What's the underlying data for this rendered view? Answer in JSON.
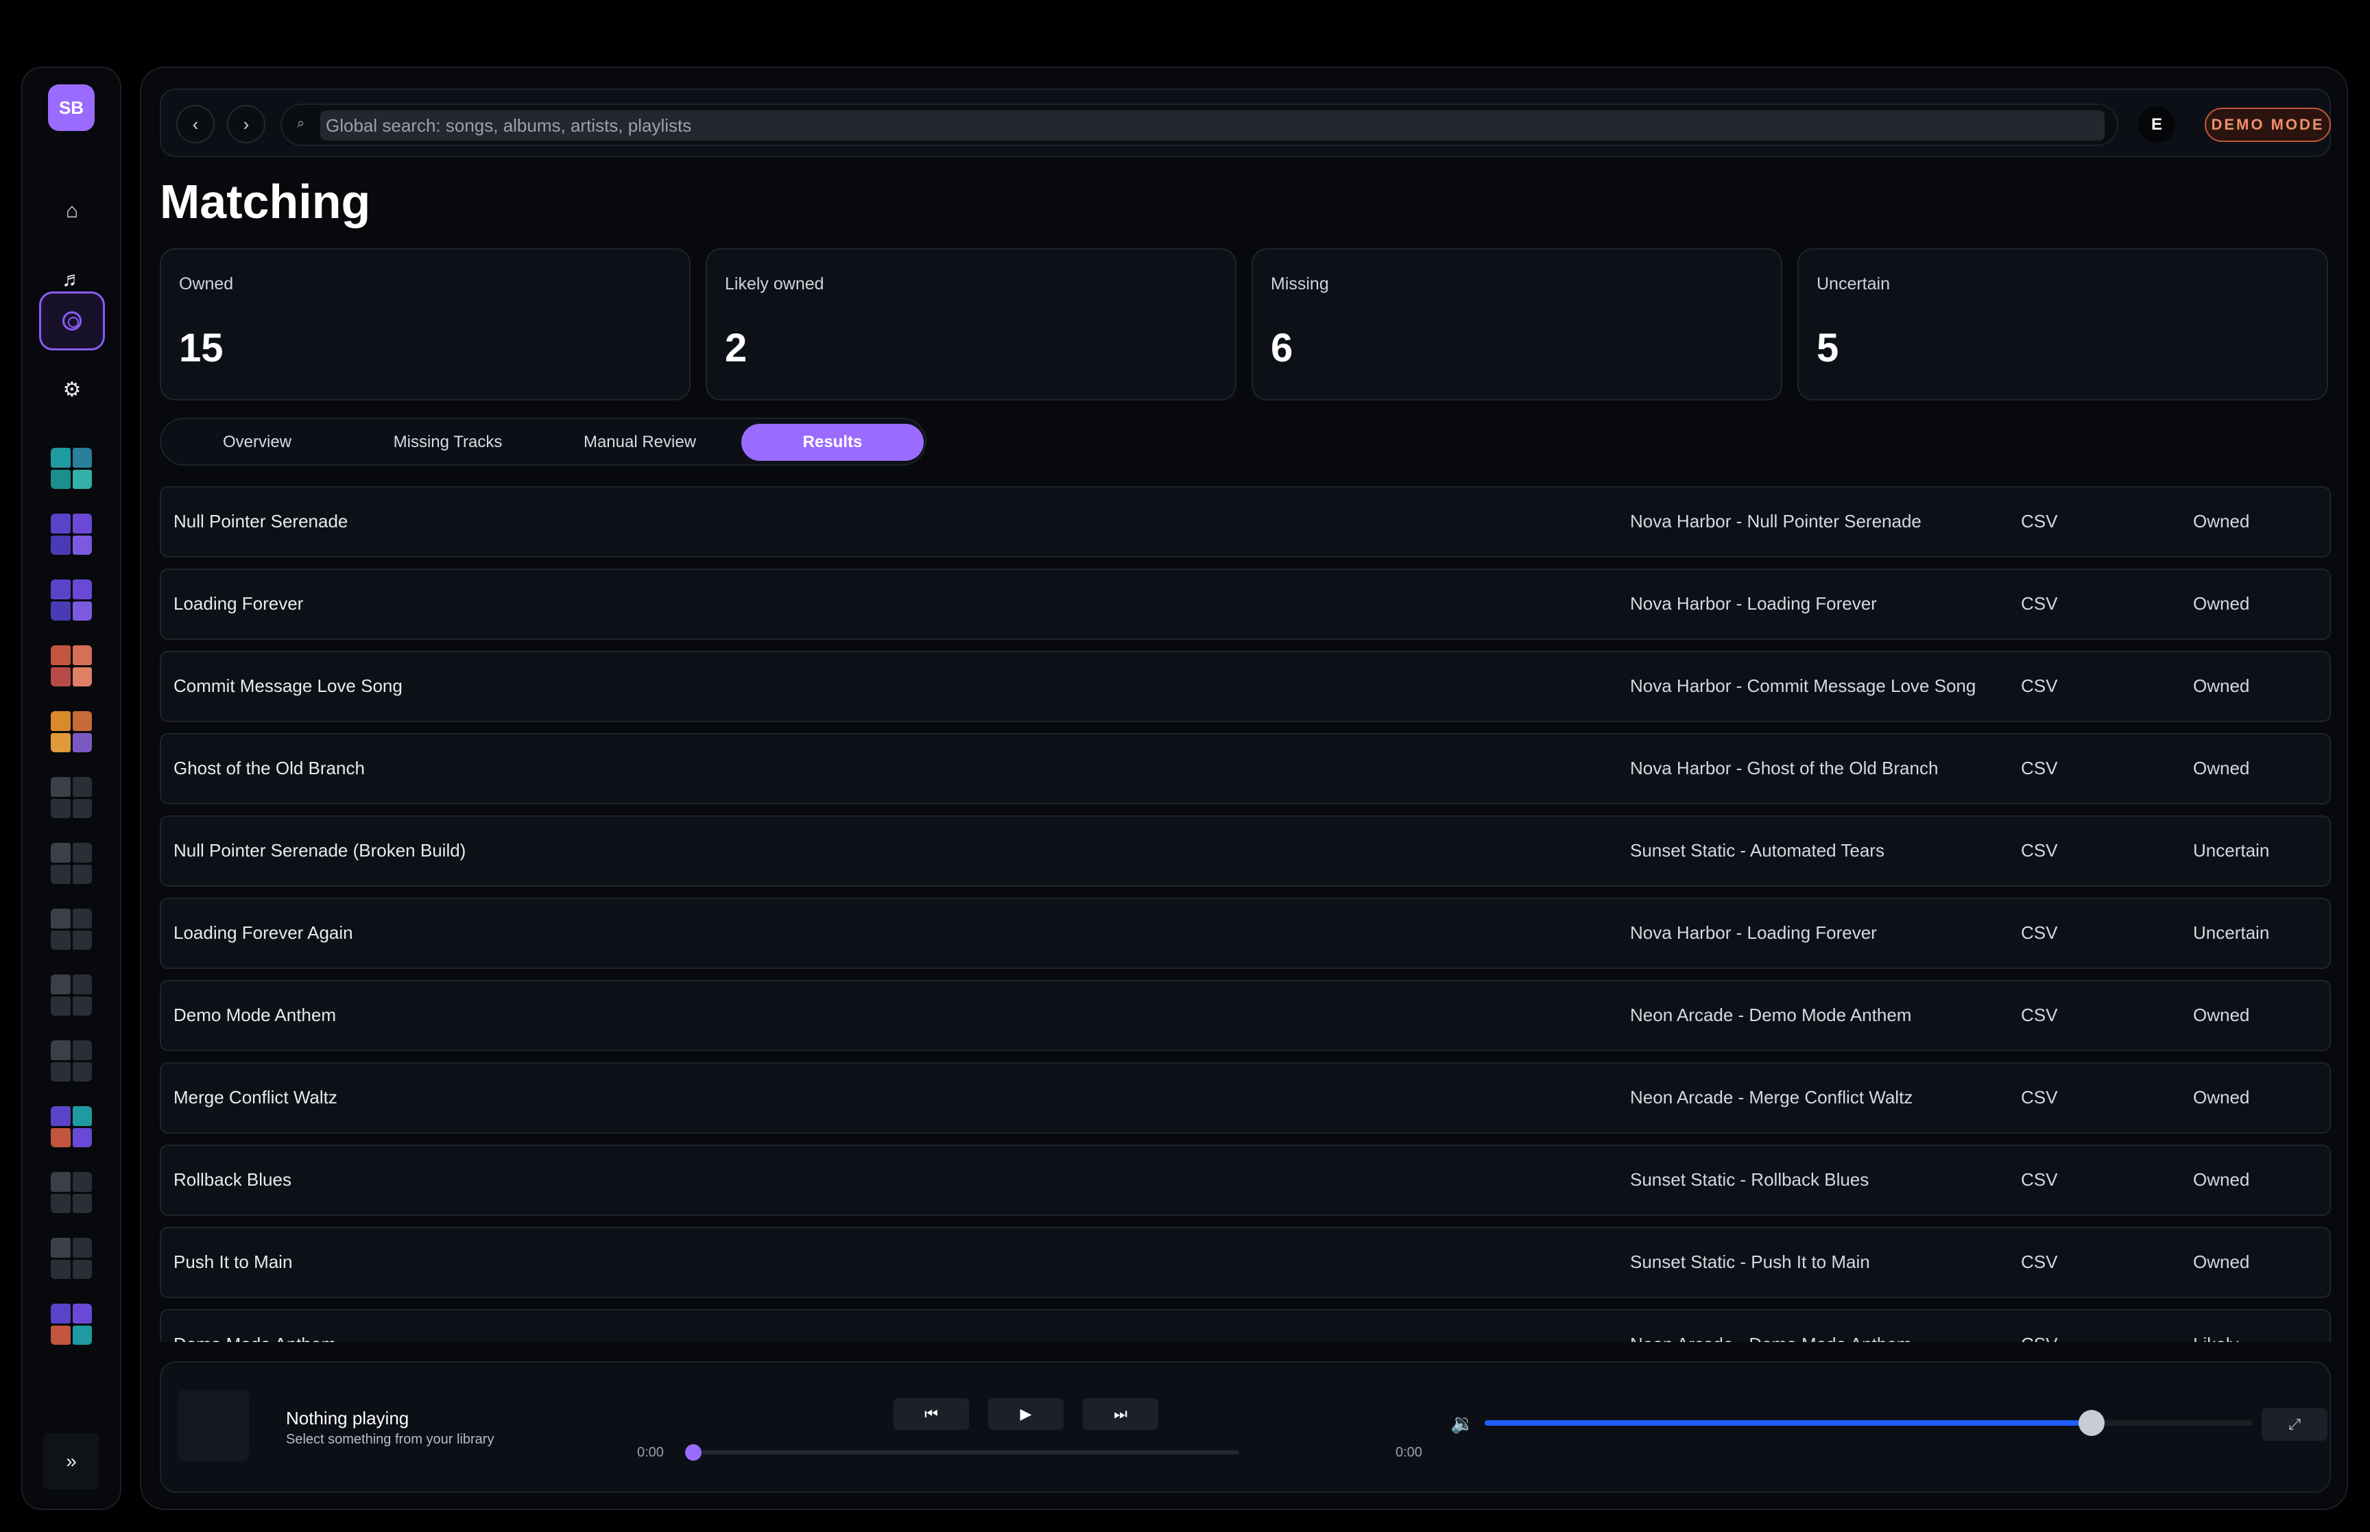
{
  "sidebar": {
    "avatar": "SB",
    "nav": [
      {
        "name": "home-icon",
        "glyph": "⌂"
      },
      {
        "name": "music-note-icon",
        "glyph": "♬"
      },
      {
        "name": "matching-icon",
        "glyph": ""
      },
      {
        "name": "gear-icon",
        "glyph": "⚙"
      }
    ],
    "expand_glyph": "»"
  },
  "topbar": {
    "back_glyph": "‹",
    "forward_glyph": "›",
    "search_glyph": "⌕",
    "search_placeholder": "Global search: songs, albums, artists, playlists",
    "user_initial": "E",
    "demo_badge": "DEMO MODE"
  },
  "page": {
    "title": "Matching"
  },
  "stats": [
    {
      "label": "Owned",
      "value": "15"
    },
    {
      "label": "Likely owned",
      "value": "2"
    },
    {
      "label": "Missing",
      "value": "6"
    },
    {
      "label": "Uncertain",
      "value": "5"
    }
  ],
  "tabs": [
    {
      "label": "Overview",
      "active": false
    },
    {
      "label": "Missing Tracks",
      "active": false
    },
    {
      "label": "Manual Review",
      "active": false
    },
    {
      "label": "Results",
      "active": true
    }
  ],
  "results": [
    {
      "title": "Null Pointer Serenade",
      "match": "Nova Harbor - Null Pointer Serenade",
      "source": "CSV",
      "status": "Owned"
    },
    {
      "title": "Loading Forever",
      "match": "Nova Harbor - Loading Forever",
      "source": "CSV",
      "status": "Owned"
    },
    {
      "title": "Commit Message Love Song",
      "match": "Nova Harbor - Commit Message Love Song",
      "source": "CSV",
      "status": "Owned"
    },
    {
      "title": "Ghost of the Old Branch",
      "match": "Nova Harbor - Ghost of the Old Branch",
      "source": "CSV",
      "status": "Owned"
    },
    {
      "title": "Null Pointer Serenade (Broken Build)",
      "match": "Sunset Static - Automated Tears",
      "source": "CSV",
      "status": "Uncertain"
    },
    {
      "title": "Loading Forever Again",
      "match": "Nova Harbor - Loading Forever",
      "source": "CSV",
      "status": "Uncertain"
    },
    {
      "title": "Demo Mode Anthem",
      "match": "Neon Arcade - Demo Mode Anthem",
      "source": "CSV",
      "status": "Owned"
    },
    {
      "title": "Merge Conflict Waltz",
      "match": "Neon Arcade - Merge Conflict Waltz",
      "source": "CSV",
      "status": "Owned"
    },
    {
      "title": "Rollback Blues",
      "match": "Sunset Static - Rollback Blues",
      "source": "CSV",
      "status": "Owned"
    },
    {
      "title": "Push It to Main",
      "match": "Sunset Static - Push It to Main",
      "source": "CSV",
      "status": "Owned"
    },
    {
      "title": "Demo Mode Anthem",
      "match": "Neon Arcade - Demo Mode Anthem",
      "source": "CSV",
      "status": "Likely..."
    }
  ],
  "player": {
    "title": "Nothing playing",
    "subtitle": "Select something from your library",
    "prev_glyph": "⏮",
    "play_glyph": "▶",
    "next_glyph": "⏭",
    "time_current": "0:00",
    "time_total": "0:00",
    "progress": 0,
    "volume_glyph": "🔉",
    "volume": 0.79,
    "expand_glyph": "⤢"
  },
  "colors": {
    "accent": "#9a6bff",
    "volume": "#1f5fff",
    "demo": "#f08f6b"
  }
}
